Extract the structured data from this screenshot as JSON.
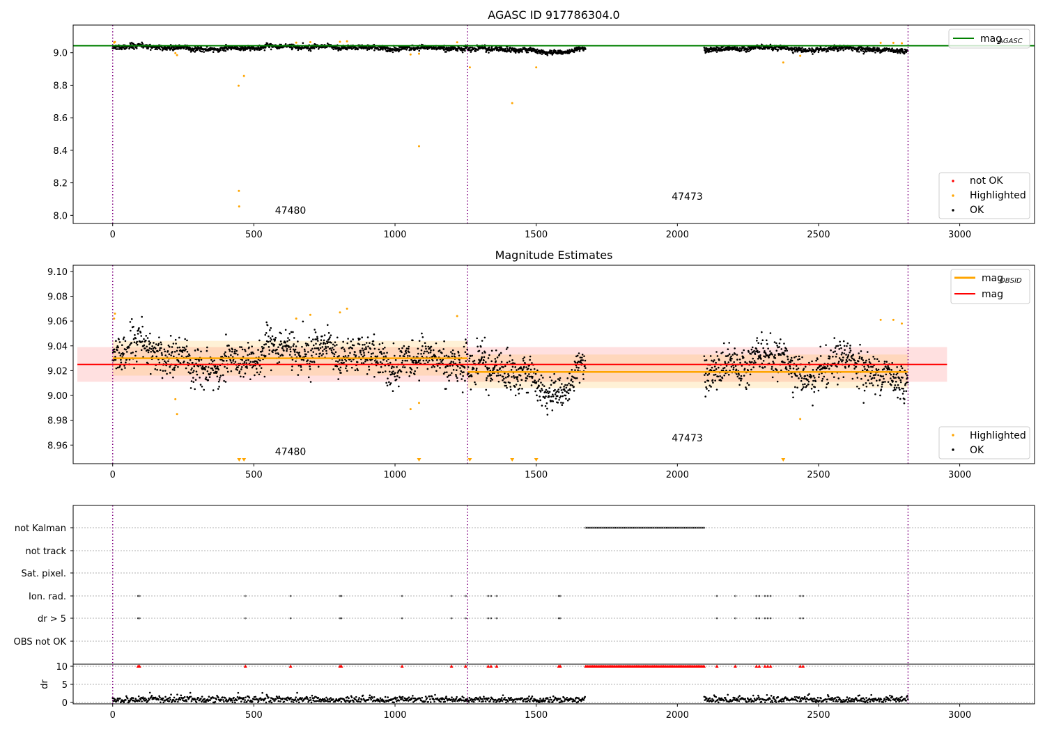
{
  "chart_data": [
    {
      "type": "scatter",
      "title": "AGASC ID 917786304.0",
      "xlim": [
        -140,
        3265
      ],
      "ylim": [
        7.95,
        9.17
      ],
      "xticks": [
        0,
        500,
        1000,
        1500,
        2000,
        2500,
        3000
      ],
      "yticks": [
        8.0,
        8.2,
        8.4,
        8.6,
        8.8,
        9.0
      ],
      "ytick_labels": [
        "8.0",
        "8.2",
        "8.4",
        "8.6",
        "8.8",
        "9.0"
      ],
      "obsid_boundaries": [
        0,
        1257,
        2817
      ],
      "obsid_labels": [
        {
          "text": "47480",
          "x": 630,
          "y": 8.01
        },
        {
          "text": "47473",
          "x": 2035,
          "y": 8.095
        }
      ],
      "reference_lines": [
        {
          "name": "mag_AGASC",
          "y": 9.043,
          "color": "#008000"
        }
      ],
      "legend_lines": [
        {
          "label": "mag",
          "sub": "AGASC",
          "color": "#008000"
        }
      ],
      "legend_points": [
        {
          "label": "not OK",
          "color": "#ff0000"
        },
        {
          "label": "Highlighted",
          "color": "#ffa500"
        },
        {
          "label": "OK",
          "color": "#000000"
        }
      ],
      "series": [
        {
          "name": "OK",
          "color": "#000000",
          "segments": [
            {
              "x0": 0,
              "x1": 1257,
              "mean": 9.03,
              "sd": 0.012
            },
            {
              "x0": 1257,
              "x1": 1675,
              "mean": 9.02,
              "sd": 0.012
            },
            {
              "x0": 2095,
              "x1": 2817,
              "mean": 9.02,
              "sd": 0.012
            }
          ]
        },
        {
          "name": "Highlighted",
          "color": "#ffa500",
          "points": [
            [
              5,
              9.062
            ],
            [
              8,
              9.066
            ],
            [
              222,
              8.997
            ],
            [
              228,
              8.985
            ],
            [
              446,
              8.797
            ],
            [
              447,
              8.15
            ],
            [
              448,
              8.055
            ],
            [
              465,
              8.857
            ],
            [
              650,
              9.062
            ],
            [
              700,
              9.065
            ],
            [
              805,
              9.067
            ],
            [
              830,
              9.07
            ],
            [
              1055,
              8.989
            ],
            [
              1085,
              8.994
            ],
            [
              1085,
              8.425
            ],
            [
              1220,
              9.064
            ],
            [
              1265,
              8.91
            ],
            [
              1415,
              8.69
            ],
            [
              1500,
              8.91
            ],
            [
              2375,
              8.94
            ],
            [
              2435,
              8.981
            ],
            [
              2720,
              9.061
            ],
            [
              2765,
              9.061
            ],
            [
              2795,
              9.058
            ]
          ]
        }
      ]
    },
    {
      "type": "scatter",
      "title": "Magnitude Estimates",
      "xlim": [
        -140,
        3265
      ],
      "ylim": [
        8.945,
        9.105
      ],
      "xticks": [
        0,
        500,
        1000,
        1500,
        2000,
        2500,
        3000
      ],
      "yticks": [
        8.96,
        8.98,
        9.0,
        9.02,
        9.04,
        9.06,
        9.08,
        9.1
      ],
      "ytick_labels": [
        "8.96",
        "8.98",
        "9.00",
        "9.02",
        "9.04",
        "9.06",
        "9.08",
        "9.10"
      ],
      "obsid_boundaries": [
        0,
        1257,
        2817
      ],
      "obsid_labels": [
        {
          "text": "47480",
          "x": 630,
          "y": 8.952
        },
        {
          "text": "47473",
          "x": 2035,
          "y": 8.963
        }
      ],
      "mag": {
        "y": 9.025,
        "band": [
          9.011,
          9.039
        ],
        "x_range": [
          -125,
          2955
        ],
        "color": "#ff0000"
      },
      "mag_obsid": [
        {
          "x0": 0,
          "x1": 1257,
          "y": 9.03,
          "band": [
            9.016,
            9.044
          ]
        },
        {
          "x0": 1257,
          "x1": 2817,
          "y": 9.019,
          "band": [
            9.006,
            9.033
          ]
        }
      ],
      "off_scale_markers_x": [
        448,
        465,
        1085,
        1265,
        1415,
        1500,
        2375
      ],
      "legend_lines": [
        {
          "label": "mag",
          "sub": "OBSID",
          "color": "#ffa500"
        },
        {
          "label": "mag",
          "sub": "",
          "color": "#ff0000"
        }
      ],
      "legend_points": [
        {
          "label": "Highlighted",
          "color": "#ffa500"
        },
        {
          "label": "OK",
          "color": "#000000"
        }
      ],
      "series": [
        {
          "name": "OK",
          "color": "#000000",
          "segments": [
            {
              "x0": 0,
              "x1": 1257,
              "mean": 9.03,
              "sd": 0.012
            },
            {
              "x0": 1257,
              "x1": 1675,
              "mean": 9.02,
              "sd": 0.012
            },
            {
              "x0": 2095,
              "x1": 2817,
              "mean": 9.02,
              "sd": 0.012
            }
          ]
        },
        {
          "name": "Highlighted",
          "color": "#ffa500",
          "points": [
            [
              5,
              9.062
            ],
            [
              8,
              9.066
            ],
            [
              222,
              8.997
            ],
            [
              228,
              8.985
            ],
            [
              650,
              9.062
            ],
            [
              700,
              9.065
            ],
            [
              805,
              9.067
            ],
            [
              830,
              9.07
            ],
            [
              1055,
              8.989
            ],
            [
              1085,
              8.994
            ],
            [
              1220,
              9.064
            ],
            [
              2435,
              8.981
            ],
            [
              2720,
              9.061
            ],
            [
              2765,
              9.061
            ],
            [
              2795,
              9.058
            ]
          ]
        }
      ]
    },
    {
      "type": "scatter",
      "title": "",
      "xlim": [
        -140,
        3265
      ],
      "xticks": [
        0,
        500,
        1000,
        1500,
        2000,
        2500,
        3000
      ],
      "obsid_boundaries": [
        0,
        1257,
        2817
      ],
      "flag_rows": [
        "not Kalman",
        "not track",
        "Sat. pixel.",
        "Ion. rad.",
        "dr > 5",
        "OBS not OK"
      ],
      "flags": {
        "not Kalman": [
          [
            1675,
            2095
          ]
        ],
        "Ion. rad.": [
          90,
          95,
          470,
          630,
          805,
          810,
          1025,
          1200,
          1250,
          1330,
          1340,
          1360,
          1580,
          1585,
          2140,
          2205,
          2280,
          2290,
          2310,
          2320,
          2330,
          2435,
          2445
        ],
        "dr > 5": [
          90,
          95,
          470,
          630,
          805,
          810,
          1025,
          1200,
          1250,
          1330,
          1340,
          1360,
          1580,
          1585,
          2140,
          2205,
          2280,
          2290,
          2310,
          2320,
          2330,
          2435,
          2445
        ]
      },
      "dr_panel": {
        "ylabel": "dr",
        "ylim": [
          -0.5,
          10.5
        ],
        "yticks": [
          0,
          5,
          10
        ],
        "cap": 10,
        "cap_points_x": [
          90,
          95,
          470,
          630,
          805,
          810,
          1025,
          1200,
          1250,
          1330,
          1340,
          1360,
          1580,
          1585,
          2140,
          2205,
          2280,
          2290,
          2310,
          2320,
          2330,
          2435,
          2445
        ],
        "cap_range": [
          1675,
          2095
        ]
      }
    }
  ]
}
